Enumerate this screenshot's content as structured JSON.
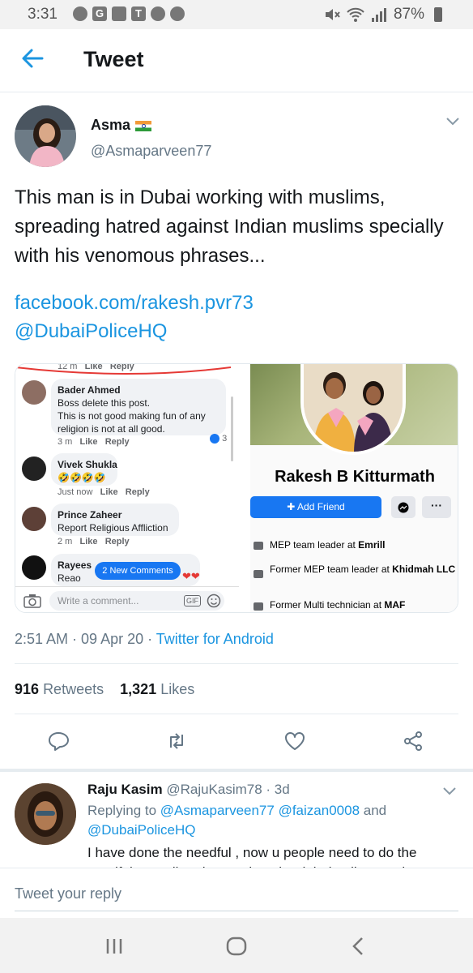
{
  "status_bar": {
    "time": "3:31",
    "left_icons": [
      "circle-badge-icon",
      "google-icon",
      "gallery-icon",
      "tmobile-icon",
      "bag-icon",
      "bag-icon"
    ],
    "battery": "87%"
  },
  "app_bar": {
    "title": "Tweet",
    "back_icon": "back-arrow-icon"
  },
  "tweet": {
    "name": "Asma",
    "handle": "@Asmaparveen77",
    "text": "This man is in Dubai working with muslims, spreading hatred against Indian muslims specially with his venomous phrases...",
    "link1": "facebook.com/rakesh.pvr73",
    "link2": "@DubaiPoliceHQ",
    "timestamp": "2:51 AM · 09 Apr 20 · ",
    "source": "Twitter for Android",
    "retweets_count": "916",
    "retweets_label": "Retweets",
    "likes_count": "1,321",
    "likes_label": "Likes"
  },
  "media_left": {
    "top_meta": {
      "time": "12 m",
      "like": "Like",
      "reply": "Reply"
    },
    "comments": [
      {
        "name": "Bader Ahmed",
        "lines": [
          "Boss delete this post.",
          "This is not good making fun of any",
          "religion is not at all good."
        ],
        "time": "3 m",
        "like": "Like",
        "reply": "Reply",
        "reactions": "3"
      },
      {
        "name": "Vivek Shukla",
        "lines": [
          "🤣🤣🤣🤣"
        ],
        "time": "Just now",
        "like": "Like",
        "reply": "Reply"
      },
      {
        "name": "Prince Zaheer",
        "lines": [
          "Report Religious Affliction"
        ],
        "time": "2 m",
        "like": "Like",
        "reply": "Reply"
      },
      {
        "name": "Rayees",
        "lines": [
          "Reao"
        ],
        "hearts": "❤❤"
      }
    ],
    "new_comments": "2 New Comments",
    "write_placeholder": "Write a comment...",
    "gif_label": "GIF"
  },
  "media_right": {
    "profile_name": "Rakesh B Kitturmath",
    "add_friend": "Add Friend",
    "more": "···",
    "work": [
      {
        "prefix": "MEP team leader at ",
        "place": "Emrill"
      },
      {
        "prefix": "Former MEP team leader at ",
        "place": "Khidmah LLC"
      },
      {
        "prefix": "Former Multi  technician at ",
        "place": "MAF"
      }
    ]
  },
  "reply": {
    "name": "Raju Kasim",
    "handle_time": "@RajuKasim78 · 3d",
    "replying_to_label": "Replying to ",
    "mention1": "@Asmaparveen77",
    "mention2": "@faizan0008",
    "and": " and ",
    "mention3": "@DubaiPoliceHQ",
    "text": "I have done the needful , now u people need to do the needful as well and report it to the dubai police to take"
  },
  "reply_bar": {
    "placeholder": "Tweet your reply"
  },
  "colors": {
    "accent": "#1b95e0",
    "facebook_blue": "#1877f2",
    "muted": "#657786"
  }
}
